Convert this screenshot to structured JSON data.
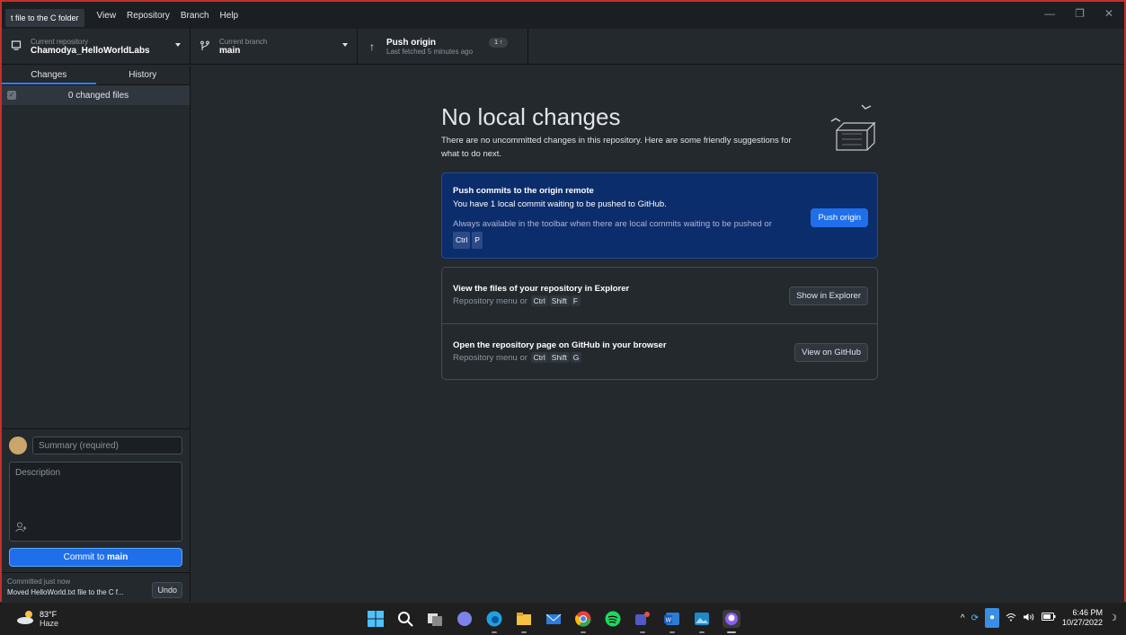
{
  "titlebar": {
    "tooltip": "t file to the C folder",
    "menu": [
      "View",
      "Repository",
      "Branch",
      "Help"
    ]
  },
  "toolbar": {
    "repo_small": "Current repository",
    "repo_name": "Chamodya_HelloWorldLabs",
    "branch_small": "Current branch",
    "branch_name": "main",
    "push_title": "Push origin",
    "push_sub": "Last fetched 5 minutes ago",
    "push_badge": "1 ↑"
  },
  "sidebar": {
    "tabs": [
      "Changes",
      "History"
    ],
    "changed_files": "0 changed files",
    "summary_placeholder": "Summary (required)",
    "description_placeholder": "Description",
    "commit_button_prefix": "Commit to ",
    "commit_button_branch": "main",
    "last_commit_time": "Committed just now",
    "last_commit_msg": "Moved HelloWorld.txt file to the C f...",
    "undo_label": "Undo"
  },
  "main": {
    "heading": "No local changes",
    "subtext": "There are no uncommitted changes in this repository. Here are some friendly suggestions for what to do next.",
    "push_card": {
      "title": "Push commits to the origin remote",
      "desc": "You have 1 local commit waiting to be pushed to GitHub.",
      "hint": "Always available in the toolbar when there are local commits waiting to be pushed or",
      "keys": [
        "Ctrl",
        "P"
      ],
      "button": "Push origin"
    },
    "explorer_card": {
      "title": "View the files of your repository in Explorer",
      "desc": "Repository menu or",
      "keys": [
        "Ctrl",
        "Shift",
        "F"
      ],
      "button": "Show in Explorer"
    },
    "github_card": {
      "title": "Open the repository page on GitHub in your browser",
      "desc": "Repository menu or",
      "keys": [
        "Ctrl",
        "Shift",
        "G"
      ],
      "button": "View on GitHub"
    }
  },
  "taskbar": {
    "temp": "83°F",
    "weather": "Haze",
    "time": "6:46 PM",
    "date": "10/27/2022",
    "apps": [
      "windows-start",
      "search",
      "task-view",
      "chat",
      "edge",
      "file-explorer",
      "mail",
      "chrome",
      "spotify",
      "teams",
      "word",
      "photos",
      "github-desktop"
    ]
  },
  "colors": {
    "accent": "#1f6feb",
    "push_card_bg": "#0c2d6b",
    "bg": "#24292e"
  }
}
